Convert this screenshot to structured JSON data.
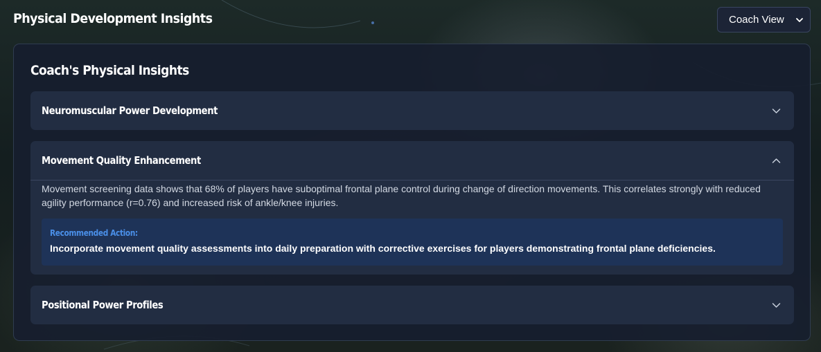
{
  "header": {
    "title": "Physical Development Insights",
    "view_select": {
      "selected": "Coach View",
      "icon": "chevron-down-icon"
    }
  },
  "panel": {
    "title": "Coach's Physical Insights",
    "sections": [
      {
        "title": "Neuromuscular Power Development",
        "expanded": false,
        "icon": "chevron-down-icon"
      },
      {
        "title": "Movement Quality Enhancement",
        "expanded": true,
        "icon": "chevron-up-icon",
        "body": "Movement screening data shows that 68% of players have suboptimal frontal plane control during change of direction movements. This correlates strongly with reduced agility performance (r=0.76) and increased risk of ankle/knee injuries.",
        "recommendation_label": "Recommended Action:",
        "recommendation_text": "Incorporate movement quality assessments into daily preparation with corrective exercises for players demonstrating frontal plane deficiencies."
      },
      {
        "title": "Positional Power Profiles",
        "expanded": false,
        "icon": "chevron-down-icon"
      }
    ]
  },
  "colors": {
    "panel_bg": "#171e2e",
    "section_bg": "#222d42",
    "recommendation_bg": "#1e3358",
    "recommendation_label": "#4a8fe8"
  }
}
